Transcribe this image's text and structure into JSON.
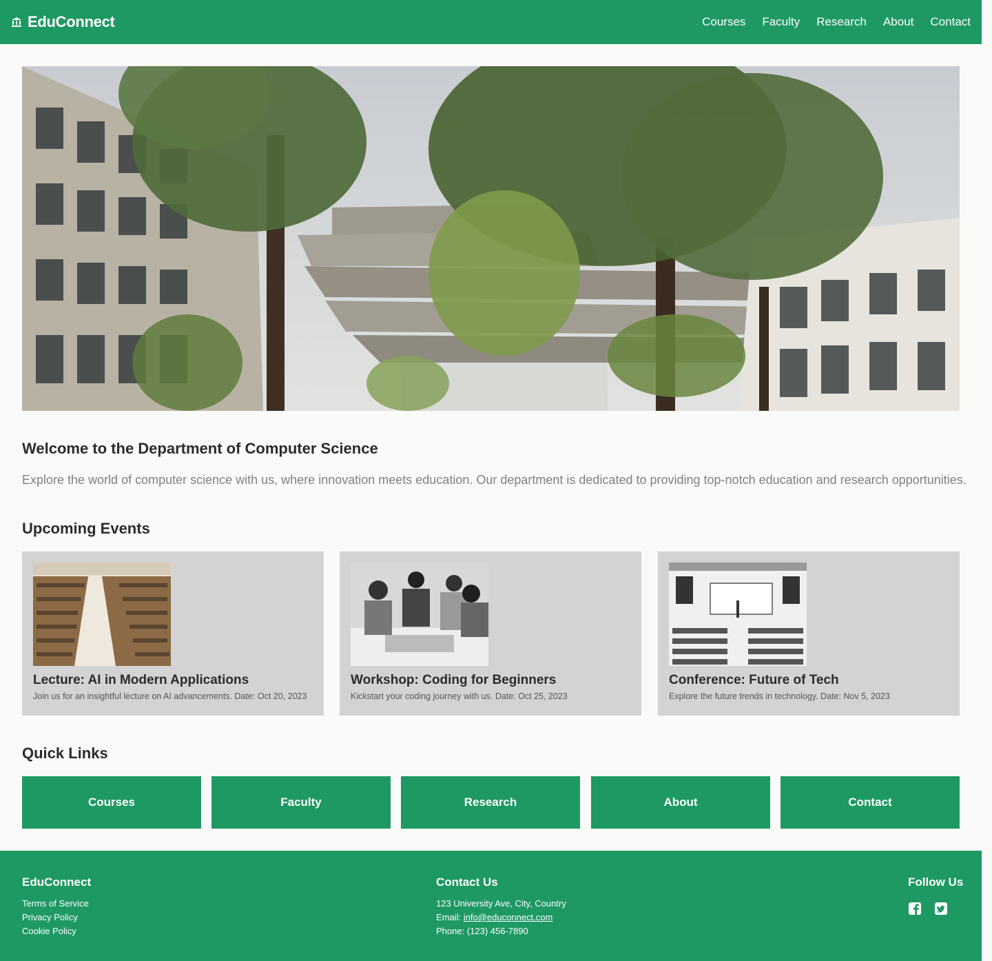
{
  "header": {
    "brand_name": "EduConnect",
    "brand_icon": "university-icon",
    "nav": [
      "Courses",
      "Faculty",
      "Research",
      "About",
      "Contact"
    ]
  },
  "hero": {
    "image": "campus-photo"
  },
  "welcome": {
    "title": "Welcome to the Department of Computer Science",
    "text": "Explore the world of computer science with us, where innovation meets education. Our department is dedicated to providing top-notch education and research opportunities."
  },
  "events": {
    "title": "Upcoming Events",
    "items": [
      {
        "title": "Lecture: AI in Modern Applications",
        "desc": "Join us for an insightful lecture on AI advancements. Date: Oct 20, 2023"
      },
      {
        "title": "Workshop: Coding for Beginners",
        "desc": "Kickstart your coding journey with us. Date: Oct 25, 2023"
      },
      {
        "title": "Conference: Future of Tech",
        "desc": "Explore the future trends in technology. Date: Nov 5, 2023"
      }
    ]
  },
  "quick_links": {
    "title": "Quick Links",
    "items": [
      "Courses",
      "Faculty",
      "Research",
      "About",
      "Contact"
    ]
  },
  "footer": {
    "brand": "EduConnect",
    "links": [
      "Terms of Service",
      "Privacy Policy",
      "Cookie Policy"
    ],
    "contact_title": "Contact Us",
    "address": "123 University Ave, City, Country",
    "email_label": "Email: ",
    "email": "info@educonnect.com",
    "phone": "Phone: (123) 456-7890",
    "follow_title": "Follow Us",
    "social_icons": [
      "facebook-icon",
      "twitter-icon"
    ]
  },
  "colors": {
    "primary": "#1e9963",
    "card": "#d3d3d3",
    "background": "#fafaf8"
  }
}
